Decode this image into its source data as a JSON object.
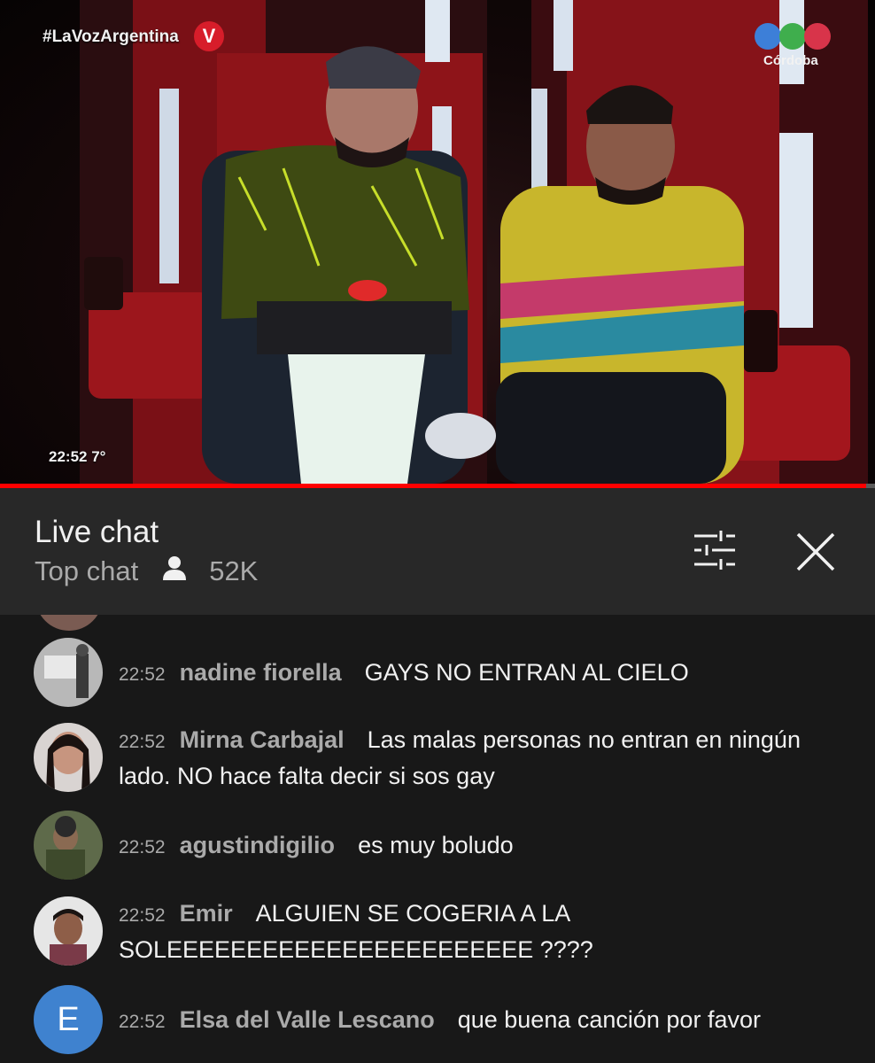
{
  "video": {
    "hashtag": "#LaVozArgentina",
    "channel_badge": "V",
    "station_label": "Córdoba",
    "station_colors": [
      "#3d7fd8",
      "#3fae4d",
      "#d8344a"
    ],
    "clock": "22:52  7°",
    "progress_fraction": 0.99,
    "accent_color": "#ff0000"
  },
  "chat": {
    "title": "Live chat",
    "mode": "Top chat",
    "viewers": "52K",
    "messages": [
      {
        "time": "22:52",
        "author": "nadine fiorella",
        "text": "GAYS NO ENTRAN AL CIELO",
        "avatar": "photo"
      },
      {
        "time": "22:52",
        "author": "Mirna Carbajal",
        "text": "Las malas personas no entran en ningún lado. NO hace falta decir si sos gay",
        "avatar": "photo"
      },
      {
        "time": "22:52",
        "author": "agustindigilio",
        "text": "es muy boludo",
        "avatar": "photo"
      },
      {
        "time": "22:52",
        "author": "Emir",
        "text": "ALGUIEN SE COGERIA A LA SOLEEEEEEEEEEEEEEEEEEEEEEE ????",
        "avatar": "photo"
      },
      {
        "time": "22:52",
        "author": "Elsa del Valle Lescano",
        "text": "que buena canción por favor",
        "avatar": "letter",
        "letter": "E"
      }
    ]
  }
}
